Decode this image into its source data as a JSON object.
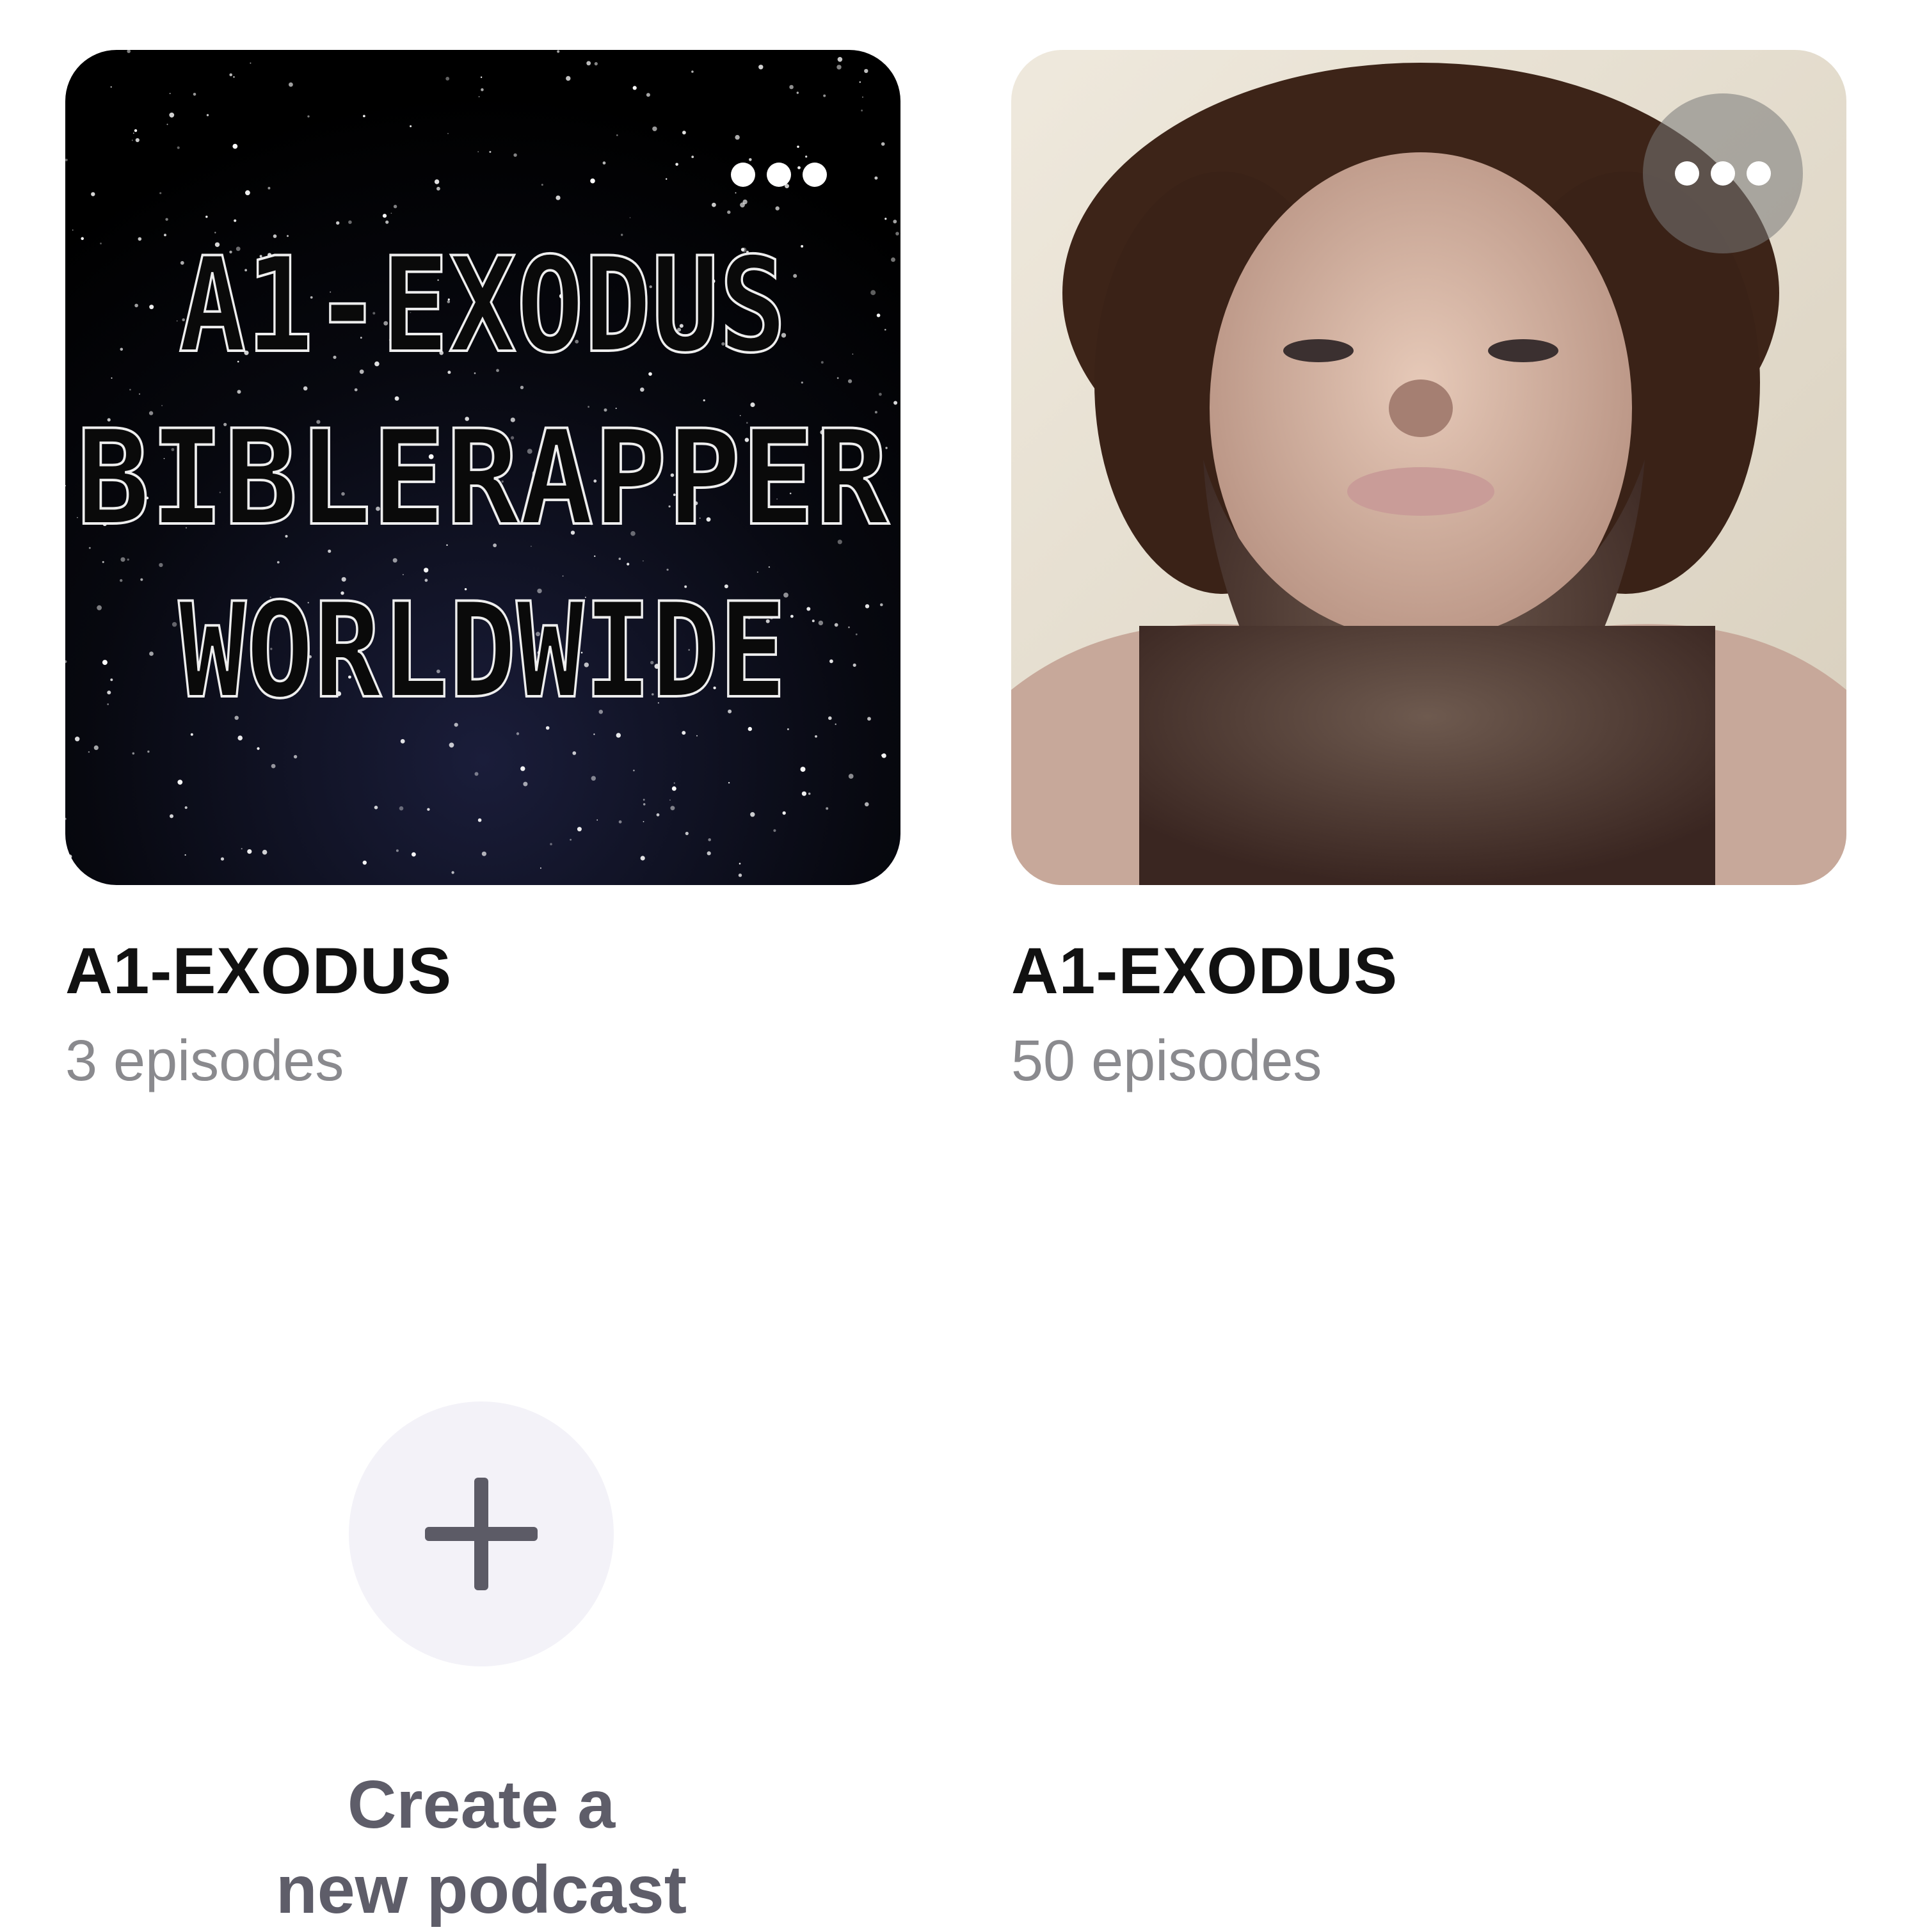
{
  "podcasts": [
    {
      "title": "A1-EXODUS",
      "subtitle": "3 episodes",
      "artwork_text": [
        "A1-EXODUS",
        "BIBLERAPPER",
        "WORLDWIDE"
      ],
      "more_icon": "ellipsis-icon"
    },
    {
      "title": "A1-EXODUS",
      "subtitle": "50 episodes",
      "more_icon": "ellipsis-icon"
    }
  ],
  "create": {
    "icon": "plus-icon",
    "line1": "Create a",
    "line2": "new podcast"
  },
  "colors": {
    "title": "#111111",
    "subtitle": "#8a8a8e",
    "create_circle": "#f3f2f8",
    "create_text": "#5e5d69"
  }
}
